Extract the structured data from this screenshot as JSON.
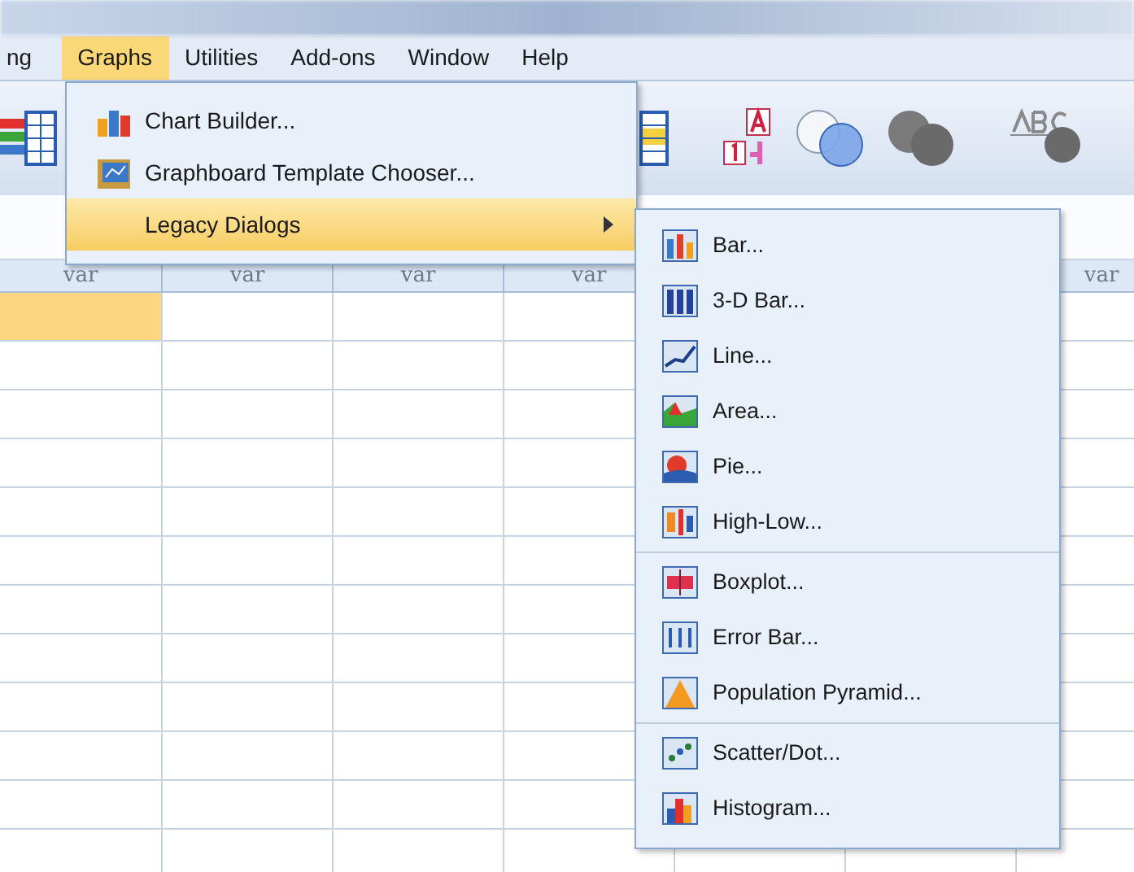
{
  "menubar": [
    {
      "label": "ng",
      "selected": false
    },
    {
      "label": "Graphs",
      "selected": true
    },
    {
      "label": "Utilities",
      "selected": false
    },
    {
      "label": "Add-ons",
      "selected": false
    },
    {
      "label": "Window",
      "selected": false
    },
    {
      "label": "Help",
      "selected": false
    }
  ],
  "graphs_menu": [
    {
      "label": "Chart Builder...",
      "selected": false,
      "submenu": false
    },
    {
      "label": "Graphboard Template Chooser...",
      "selected": false,
      "submenu": false
    },
    {
      "label": "Legacy Dialogs",
      "selected": true,
      "submenu": true
    }
  ],
  "legacy_dialogs_menu": [
    [
      {
        "label": "Bar..."
      },
      {
        "label": "3-D Bar..."
      },
      {
        "label": "Line..."
      },
      {
        "label": "Area..."
      },
      {
        "label": "Pie..."
      },
      {
        "label": "High-Low..."
      }
    ],
    [
      {
        "label": "Boxplot..."
      },
      {
        "label": "Error Bar..."
      },
      {
        "label": "Population Pyramid..."
      }
    ],
    [
      {
        "label": "Scatter/Dot..."
      },
      {
        "label": "Histogram..."
      }
    ]
  ],
  "grid": {
    "columns": [
      {
        "label": "var"
      },
      {
        "label": "var"
      },
      {
        "label": "var"
      },
      {
        "label": "var"
      },
      {},
      {},
      {
        "label": "var"
      }
    ],
    "rows": [
      {
        "selected": true
      },
      {
        "selected": false
      },
      {
        "selected": false
      },
      {
        "selected": false
      },
      {
        "selected": false
      },
      {
        "selected": false
      },
      {
        "selected": false
      },
      {
        "selected": false
      },
      {
        "selected": false
      },
      {
        "selected": false
      },
      {
        "selected": false
      },
      {
        "selected": false
      }
    ]
  }
}
